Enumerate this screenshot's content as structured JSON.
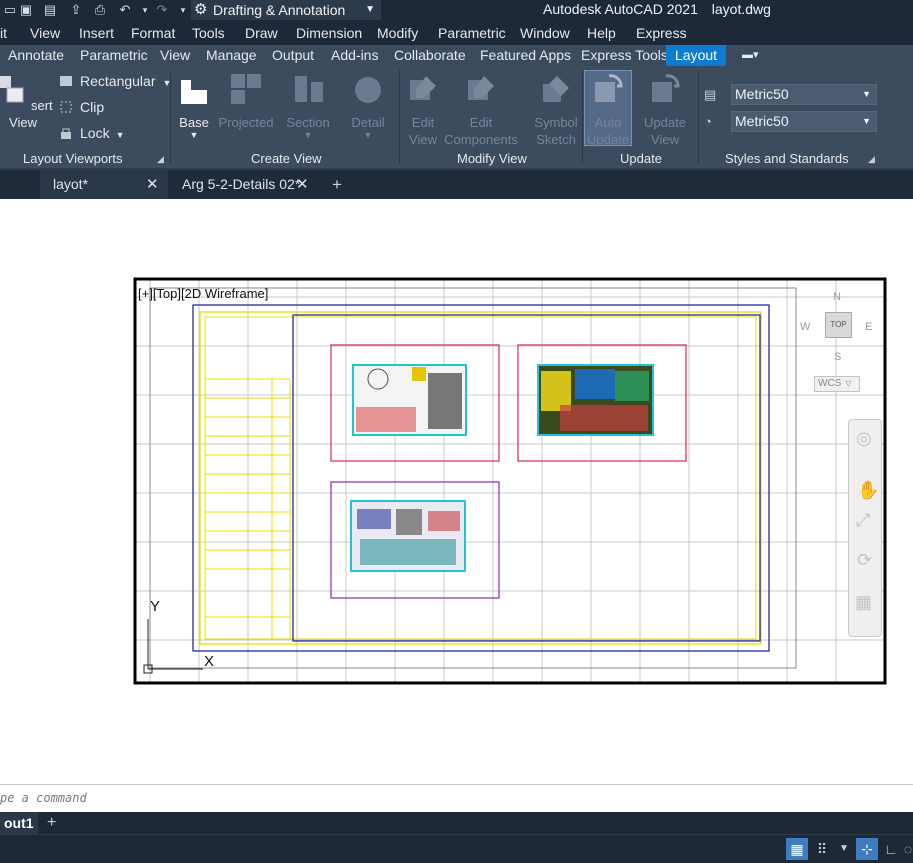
{
  "titlebar": {
    "workspace": "Drafting & Annotation",
    "app_title": "Autodesk AutoCAD 2021",
    "file_name": "layot.dwg"
  },
  "menu": [
    "it",
    "View",
    "Insert",
    "Format",
    "Tools",
    "Draw",
    "Dimension",
    "Modify",
    "Parametric",
    "Window",
    "Help",
    "Express"
  ],
  "ribbon_tabs": [
    "Annotate",
    "Parametric",
    "View",
    "Manage",
    "Output",
    "Add-ins",
    "Collaborate",
    "Featured Apps",
    "Express Tools",
    "Layout"
  ],
  "ribbon": {
    "layout_viewports": {
      "insert_view": "sert View",
      "rectangular": "Rectangular",
      "clip": "Clip",
      "lock": "Lock",
      "title": "Layout Viewports"
    },
    "create_view": {
      "base": "Base",
      "projected": "Projected",
      "section": "Section",
      "detail": "Detail",
      "title": "Create View"
    },
    "modify_view": {
      "edit_view_1": "Edit",
      "edit_view_2": "View",
      "edit_components_1": "Edit",
      "edit_components_2": "Components",
      "symbol_sketch_1": "Symbol",
      "symbol_sketch_2": "Sketch",
      "title": "Modify View"
    },
    "update": {
      "auto_update_1": "Auto",
      "auto_update_2": "Update",
      "update_view_1": "Update",
      "update_view_2": "View",
      "title": "Update"
    },
    "styles": {
      "style1": "Metric50",
      "style2": "Metric50",
      "title": "Styles and Standards"
    }
  },
  "doc_tabs": [
    "layot*",
    "Arg 5-2-Details 02*"
  ],
  "viewport": {
    "label": "[+][Top][2D Wireframe]",
    "viewcube_top": "TOP",
    "compass_n": "N",
    "compass_s": "S",
    "compass_e": "E",
    "compass_w": "W",
    "wcs": "WCS",
    "ucs_x": "X",
    "ucs_y": "Y"
  },
  "command": {
    "prompt": "pe a command"
  },
  "layout_tabs": [
    "out1"
  ],
  "colors": {
    "accent": "#0b7cd1",
    "title_bg": "#1d2938",
    "ribbon_bg": "#3d4b5f",
    "sheet_border": "#000000",
    "title_block": "#e8e000",
    "frame_blue": "#2a2a9a",
    "viewport_red": "#d63a5a",
    "viewport_purple": "#9a3aae"
  }
}
